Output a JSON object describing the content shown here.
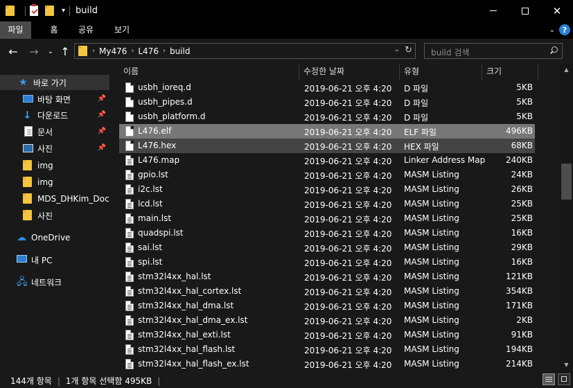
{
  "window": {
    "title": "build",
    "controls": {
      "minimize": "—",
      "maximize": "☐",
      "close": "✕"
    }
  },
  "ribbon": {
    "tabs": [
      "파일",
      "홈",
      "공유",
      "보기"
    ],
    "active_tab": "파일"
  },
  "address": {
    "breadcrumbs": [
      "My476",
      "L476",
      "build"
    ]
  },
  "search": {
    "placeholder": "build 검색"
  },
  "nav_pane": {
    "quick_access_label": "바로 가기",
    "items": [
      {
        "label": "바탕 화면",
        "icon": "desktop-icon",
        "pinned": true
      },
      {
        "label": "다운로드",
        "icon": "download-icon",
        "pinned": true
      },
      {
        "label": "문서",
        "icon": "document-icon",
        "pinned": true
      },
      {
        "label": "사진",
        "icon": "pictures-icon",
        "pinned": true
      },
      {
        "label": "img",
        "icon": "folder-icon",
        "pinned": false
      },
      {
        "label": "img",
        "icon": "folder-icon",
        "pinned": false
      },
      {
        "label": "MDS_DHKim_Docs",
        "icon": "folder-icon",
        "pinned": false
      },
      {
        "label": "사진",
        "icon": "folder-icon",
        "pinned": false
      }
    ],
    "onedrive": "OneDrive",
    "this_pc": "내 PC",
    "network": "네트워크"
  },
  "columns": {
    "name": "이름",
    "date": "수정한 날짜",
    "type": "유형",
    "size": "크기"
  },
  "files": [
    {
      "name": "usbh_ioreq.d",
      "date": "2019-06-21 오후 4:20",
      "type": "D 파일",
      "size": "5KB"
    },
    {
      "name": "usbh_pipes.d",
      "date": "2019-06-21 오후 4:20",
      "type": "D 파일",
      "size": "5KB"
    },
    {
      "name": "usbh_platform.d",
      "date": "2019-06-21 오후 4:20",
      "type": "D 파일",
      "size": "5KB"
    },
    {
      "name": "L476.elf",
      "date": "2019-06-21 오후 4:20",
      "type": "ELF 파일",
      "size": "496KB"
    },
    {
      "name": "L476.hex",
      "date": "2019-06-21 오후 4:20",
      "type": "HEX 파일",
      "size": "68KB"
    },
    {
      "name": "L476.map",
      "date": "2019-06-21 오후 4:20",
      "type": "Linker Address Map",
      "size": "240KB"
    },
    {
      "name": "gpio.lst",
      "date": "2019-06-21 오후 4:20",
      "type": "MASM Listing",
      "size": "24KB"
    },
    {
      "name": "i2c.lst",
      "date": "2019-06-21 오후 4:20",
      "type": "MASM Listing",
      "size": "26KB"
    },
    {
      "name": "lcd.lst",
      "date": "2019-06-21 오후 4:20",
      "type": "MASM Listing",
      "size": "25KB"
    },
    {
      "name": "main.lst",
      "date": "2019-06-21 오후 4:20",
      "type": "MASM Listing",
      "size": "25KB"
    },
    {
      "name": "quadspi.lst",
      "date": "2019-06-21 오후 4:20",
      "type": "MASM Listing",
      "size": "16KB"
    },
    {
      "name": "sai.lst",
      "date": "2019-06-21 오후 4:20",
      "type": "MASM Listing",
      "size": "29KB"
    },
    {
      "name": "spi.lst",
      "date": "2019-06-21 오후 4:20",
      "type": "MASM Listing",
      "size": "16KB"
    },
    {
      "name": "stm32l4xx_hal.lst",
      "date": "2019-06-21 오후 4:20",
      "type": "MASM Listing",
      "size": "121KB"
    },
    {
      "name": "stm32l4xx_hal_cortex.lst",
      "date": "2019-06-21 오후 4:20",
      "type": "MASM Listing",
      "size": "354KB"
    },
    {
      "name": "stm32l4xx_hal_dma.lst",
      "date": "2019-06-21 오후 4:20",
      "type": "MASM Listing",
      "size": "171KB"
    },
    {
      "name": "stm32l4xx_hal_dma_ex.lst",
      "date": "2019-06-21 오후 4:20",
      "type": "MASM Listing",
      "size": "2KB"
    },
    {
      "name": "stm32l4xx_hal_exti.lst",
      "date": "2019-06-21 오후 4:20",
      "type": "MASM Listing",
      "size": "91KB"
    },
    {
      "name": "stm32l4xx_hal_flash.lst",
      "date": "2019-06-21 오후 4:20",
      "type": "MASM Listing",
      "size": "194KB"
    },
    {
      "name": "stm32l4xx_hal_flash_ex.lst",
      "date": "2019-06-21 오후 4:20",
      "type": "MASM Listing",
      "size": "214KB"
    }
  ],
  "selection": {
    "hover_row": "L476.elf",
    "selected_row": "L476.hex"
  },
  "status": {
    "item_count": "144개 항목",
    "selection": "1개 항목 선택함 495KB"
  },
  "colors": {
    "background": "#191919",
    "titlebar": "#000000",
    "accent": "#3a9ee8",
    "folder": "#f4c542"
  }
}
